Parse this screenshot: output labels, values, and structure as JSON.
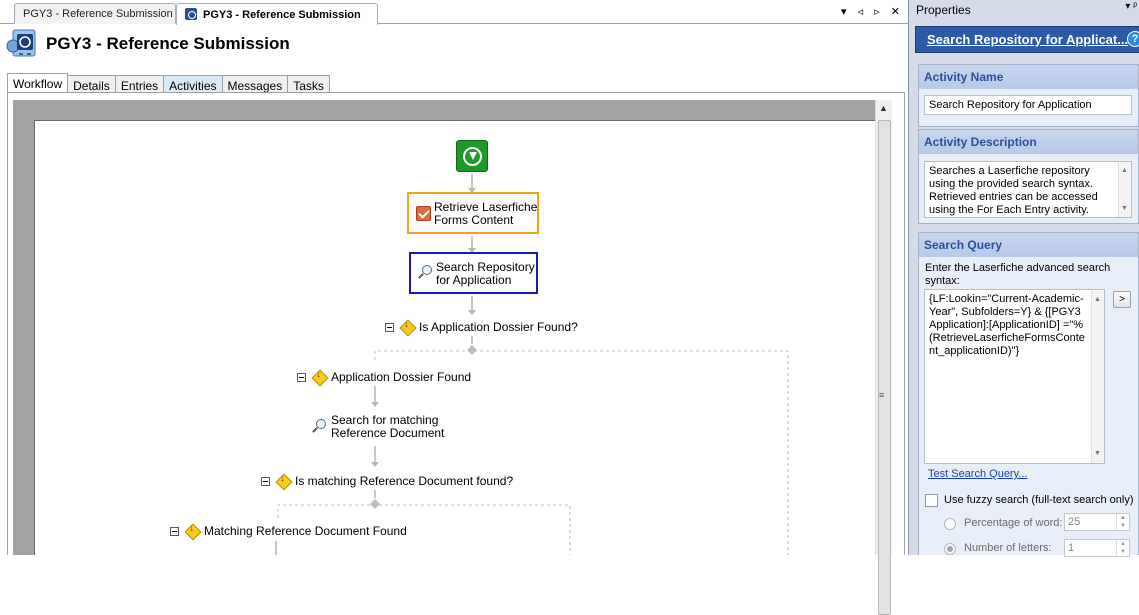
{
  "doc_tabs": [
    {
      "label": "PGY3 - Reference Submission"
    },
    {
      "label": "PGY3 - Reference Submission"
    }
  ],
  "doc_tab_controls": "▾ ◃ ▹ ✕",
  "page_title": "PGY3 - Reference Submission",
  "sub_tabs": [
    {
      "label": "Workflow"
    },
    {
      "label": "Details"
    },
    {
      "label": "Entries"
    },
    {
      "label": "Activities"
    },
    {
      "label": "Messages"
    },
    {
      "label": "Tasks"
    }
  ],
  "workflow": {
    "start_icon": "start-arrow-icon",
    "retrieve": "Retrieve Laserfiche\nForms Content",
    "search_repo": "Search Repository\nfor Application",
    "cond1": "Is Application Dossier Found?",
    "branch1": "Application Dossier Found",
    "search_ref": "Search for matching\nReference Document",
    "cond2": "Is matching Reference Document found?",
    "branch2": "Matching Reference Document Found"
  },
  "properties": {
    "header": "Properties",
    "pin": "▾ ᵖ",
    "title_link": "Search Repository for Applicat...",
    "help": "?",
    "activity_name_label": "Activity Name",
    "activity_name": "Search Repository for Application",
    "activity_desc_label": "Activity Description",
    "activity_desc": "Searches a Laserfiche repository using the provided search syntax.  Retrieved entries can be accessed using the For Each Entry activity.",
    "search_query_label": "Search Query",
    "search_query_instructions": "Enter the Laserfiche advanced search syntax:",
    "search_query": "{LF:Lookin=\"Current-Academic-Year\", Subfolders=Y} & {[PGY3 Application]:[ApplicationID] =\"%(RetrieveLaserficheFormsContent_applicationID)\"}",
    "expand_button": ">",
    "test_link": "Test Search Query...",
    "fuzzy_label": "Use fuzzy search (full-text search only)",
    "percentage_label": "Percentage of word:",
    "percentage_value": "25",
    "letters_label": "Number of letters:",
    "letters_value": "1"
  }
}
